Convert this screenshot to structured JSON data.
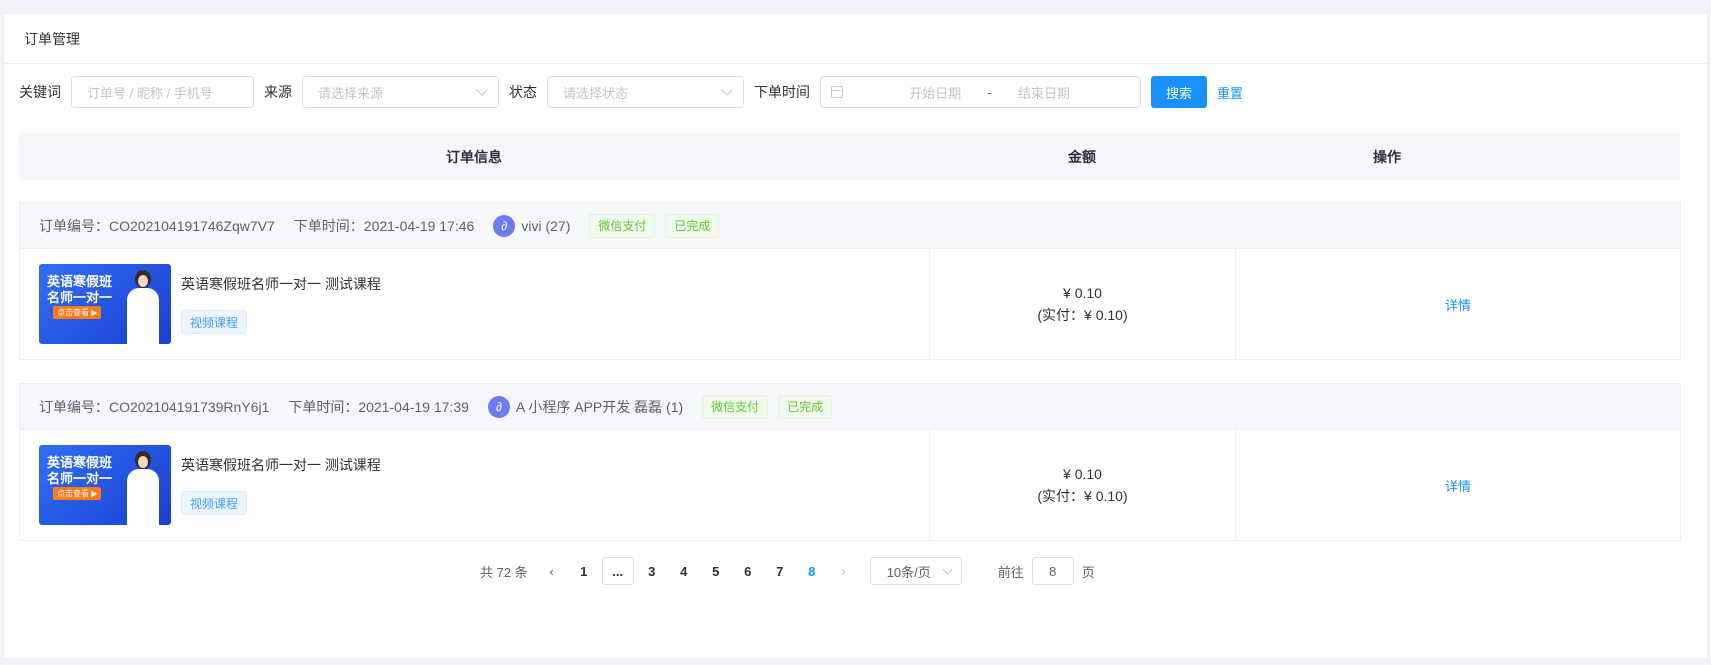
{
  "header": {
    "title": "订单管理"
  },
  "filters": {
    "keyword_label": "关键词",
    "keyword_placeholder": "订单号 / 昵称 / 手机号",
    "source_label": "来源",
    "source_placeholder": "请选择来源",
    "status_label": "状态",
    "status_placeholder": "请选择状态",
    "time_label": "下单时间",
    "start_placeholder": "开始日期",
    "range_sep": "-",
    "end_placeholder": "结束日期",
    "search_button": "搜索",
    "reset_link": "重置"
  },
  "table": {
    "columns": [
      "订单信息",
      "金额",
      "操作"
    ]
  },
  "orders": [
    {
      "order_no": "订单编号：CO202104191746Zqw7V7",
      "order_time": "下单时间：2021-04-19 17:46",
      "user": "vivi (27)",
      "pay_tag": "微信支付",
      "status_tag": "已完成",
      "thumb_line1": "英语寒假班",
      "thumb_line2": "名师一对一",
      "thumb_cta": "点击查看 ▶",
      "course_title": "英语寒假班名师一对一 测试课程",
      "course_type": "视频课程",
      "amount": "¥ 0.10",
      "paid": "(实付：¥ 0.10)",
      "action": "详情"
    },
    {
      "order_no": "订单编号：CO202104191739RnY6j1",
      "order_time": "下单时间：2021-04-19 17:39",
      "user": "A 小程序 APP开发 磊磊 (1)",
      "pay_tag": "微信支付",
      "status_tag": "已完成",
      "thumb_line1": "英语寒假班",
      "thumb_line2": "名师一对一",
      "thumb_cta": "点击查看 ▶",
      "course_title": "英语寒假班名师一对一 测试课程",
      "course_type": "视频课程",
      "amount": "¥ 0.10",
      "paid": "(实付：¥ 0.10)",
      "action": "详情"
    }
  ],
  "pagination": {
    "total": "共 72 条",
    "pages": [
      "1",
      "...",
      "3",
      "4",
      "5",
      "6",
      "7",
      "8"
    ],
    "current": "8",
    "page_size": "10条/页",
    "goto_label": "前往",
    "goto_value": "8",
    "goto_suffix": "页"
  }
}
